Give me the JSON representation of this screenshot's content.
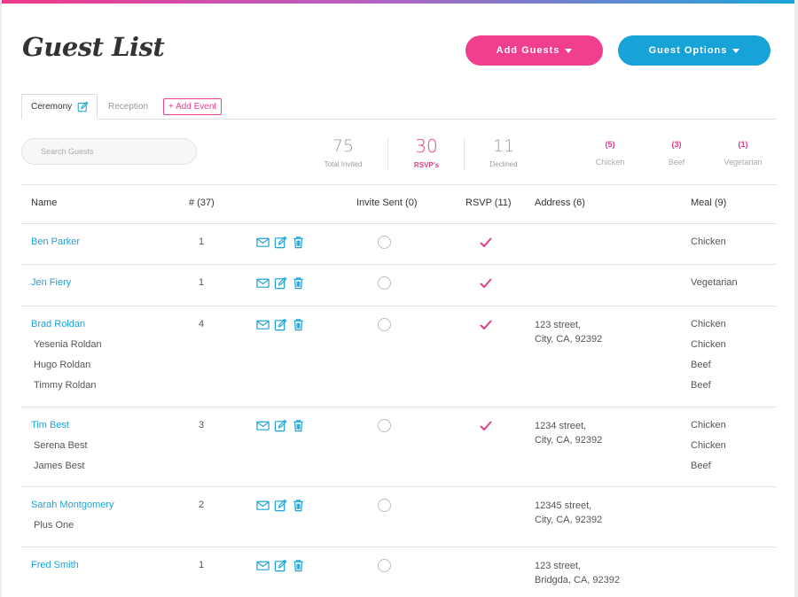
{
  "page": {
    "title": "Guest List"
  },
  "header": {
    "add_guests_label": "Add Guests",
    "guest_options_label": "Guest Options"
  },
  "tabs": [
    {
      "label": "Ceremony",
      "active": true
    },
    {
      "label": "Reception",
      "active": false
    }
  ],
  "add_event_label": "+ Add Event",
  "search": {
    "placeholder": "Search Guests"
  },
  "stats": {
    "total_invited": {
      "value": "75",
      "label": "Total Invited"
    },
    "rsvps": {
      "value": "30",
      "label": "RSVP's"
    },
    "declined": {
      "value": "11",
      "label": "Declined"
    }
  },
  "meal_summary": [
    {
      "count": "(5)",
      "label": "Chicken"
    },
    {
      "count": "(3)",
      "label": "Beef"
    },
    {
      "count": "(1)",
      "label": "Vegetarian"
    }
  ],
  "table": {
    "columns": {
      "name": "Name",
      "count": "# (37)",
      "invite_sent": "Invite Sent (0)",
      "rsvp": "RSVP (11)",
      "address": "Address (6)",
      "meal": "Meal (9)"
    },
    "rows": [
      {
        "primary": "Ben Parker",
        "count": "1",
        "members": [],
        "rsvp": true,
        "address": [],
        "meals": [
          "Chicken"
        ]
      },
      {
        "primary": "Jen Fiery",
        "count": "1",
        "members": [],
        "rsvp": true,
        "address": [],
        "meals": [
          "Vegetarian"
        ]
      },
      {
        "primary": "Brad Roldan",
        "count": "4",
        "members": [
          "Yesenia Roldan",
          "Hugo Roldan",
          "Timmy Roldan"
        ],
        "rsvp": true,
        "address": [
          "123 street,",
          "City, CA, 92392"
        ],
        "meals": [
          "Chicken",
          "Chicken",
          "Beef",
          "Beef"
        ]
      },
      {
        "primary": "Tim Best",
        "count": "3",
        "members": [
          "Serena Best",
          "James Best"
        ],
        "rsvp": true,
        "address": [
          "1234 street,",
          "City, CA, 92392"
        ],
        "meals": [
          "Chicken",
          "Chicken",
          "Beef"
        ]
      },
      {
        "primary": "Sarah Montgomery",
        "count": "2",
        "members": [
          "Plus One"
        ],
        "rsvp": false,
        "address": [
          "12345 street,",
          "City, CA, 92392"
        ],
        "meals": []
      },
      {
        "primary": "Fred Smith",
        "count": "1",
        "members": [],
        "rsvp": false,
        "address": [
          "123 street,",
          "Bridgda, CA, 92392"
        ],
        "meals": []
      }
    ]
  },
  "colors": {
    "pink": "#ef3f8e",
    "blue": "#17a3d8",
    "link": "#1da3d6"
  },
  "icons": {
    "row_actions": [
      "mail-icon",
      "edit-icon",
      "trash-icon"
    ],
    "tab_edit": "edit-icon"
  }
}
